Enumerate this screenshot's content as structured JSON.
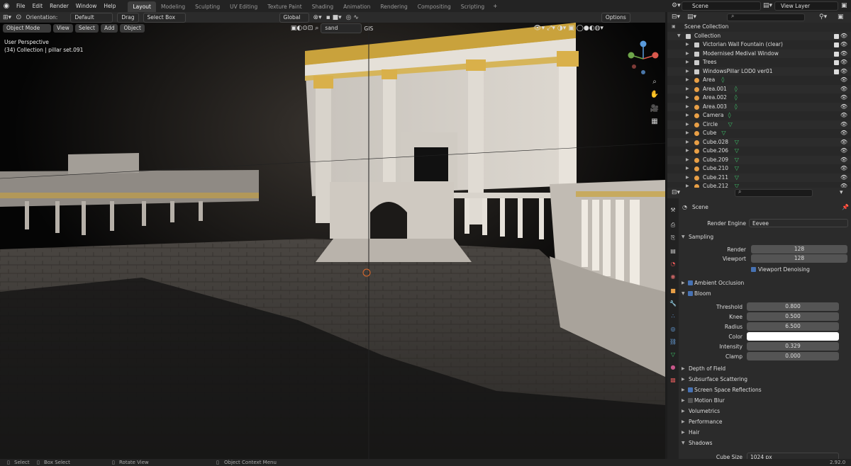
{
  "menu": {
    "items": [
      "File",
      "Edit",
      "Render",
      "Window",
      "Help"
    ]
  },
  "workspaces": [
    "Layout",
    "Modeling",
    "Sculpting",
    "UV Editing",
    "Texture Paint",
    "Shading",
    "Animation",
    "Rendering",
    "Compositing",
    "Scripting"
  ],
  "active_workspace": "Layout",
  "plus": "+",
  "scene_name": "Scene",
  "view_layer": "View Layer",
  "vp_header": {
    "orientation_label": "Orientation:",
    "orientation_value": "Default",
    "drag_label": "Drag",
    "drag_value": "Select Box",
    "transform_value": "Global",
    "options_label": "Options"
  },
  "vp_toolbar": {
    "mode": "Object Mode",
    "view": "View",
    "select": "Select",
    "add": "Add",
    "object": "Object",
    "search_value": "sand",
    "gis": "GIS"
  },
  "vp_info": {
    "line1": "User Perspective",
    "line2": "(34) Collection | pillar set.091"
  },
  "outliner": {
    "root": "Scene Collection",
    "rows": [
      {
        "name": "Collection",
        "indent": 1,
        "type": "collection"
      },
      {
        "name": "Victorian Wall Fountain (clear)",
        "indent": 2,
        "type": "collection"
      },
      {
        "name": "Modernised Medival Window",
        "indent": 2,
        "type": "collection"
      },
      {
        "name": "Trees",
        "indent": 2,
        "type": "collection"
      },
      {
        "name": "WindowsPillar LOD0 ver01",
        "indent": 2,
        "type": "collection"
      },
      {
        "name": "Area",
        "indent": 2,
        "type": "light"
      },
      {
        "name": "Area.001",
        "indent": 2,
        "type": "light"
      },
      {
        "name": "Area.002",
        "indent": 2,
        "type": "light"
      },
      {
        "name": "Area.003",
        "indent": 2,
        "type": "light"
      },
      {
        "name": "Camera",
        "indent": 2,
        "type": "camera"
      },
      {
        "name": "Circle",
        "indent": 2,
        "type": "mesh"
      },
      {
        "name": "Cube",
        "indent": 2,
        "type": "mesh"
      },
      {
        "name": "Cube.028",
        "indent": 2,
        "type": "mesh"
      },
      {
        "name": "Cube.206",
        "indent": 2,
        "type": "mesh"
      },
      {
        "name": "Cube.209",
        "indent": 2,
        "type": "mesh"
      },
      {
        "name": "Cube.210",
        "indent": 2,
        "type": "mesh"
      },
      {
        "name": "Cube.211",
        "indent": 2,
        "type": "mesh"
      },
      {
        "name": "Cube.212",
        "indent": 2,
        "type": "mesh"
      }
    ]
  },
  "props": {
    "scene_label": "Scene",
    "render_engine_label": "Render Engine",
    "render_engine_value": "Eevee",
    "sampling": "Sampling",
    "render_label": "Render",
    "render_value": "128",
    "viewport_label": "Viewport",
    "viewport_value": "128",
    "viewport_denoising": "Viewport Denoising",
    "ambient_occlusion": "Ambient Occlusion",
    "bloom": "Bloom",
    "threshold_label": "Threshold",
    "threshold_value": "0.800",
    "threshold_fill": 0.06,
    "knee_label": "Knee",
    "knee_value": "0.500",
    "knee_fill": 0.5,
    "radius_label": "Radius",
    "radius_value": "6.500",
    "radius_fill": 1.0,
    "color_label": "Color",
    "intensity_label": "Intensity",
    "intensity_value": "0.329",
    "intensity_fill": 0.66,
    "clamp_label": "Clamp",
    "clamp_value": "0.000",
    "sections": [
      "Depth of Field",
      "Subsurface Scattering",
      "Screen Space Reflections",
      "Motion Blur",
      "Volumetrics",
      "Performance",
      "Hair",
      "Shadows"
    ],
    "cube_size_label": "Cube Size",
    "cube_size_value": "1024 px"
  },
  "status": {
    "select": "Select",
    "box_select": "Box Select",
    "rotate_view": "Rotate View",
    "context_menu": "Object Context Menu",
    "version": "2.92.0"
  },
  "colors": {
    "accent": "#4772b3",
    "gold": "#c9a23c",
    "orange": "#e89f46",
    "green": "#3ec56b",
    "purple": "#8c5ad8"
  }
}
